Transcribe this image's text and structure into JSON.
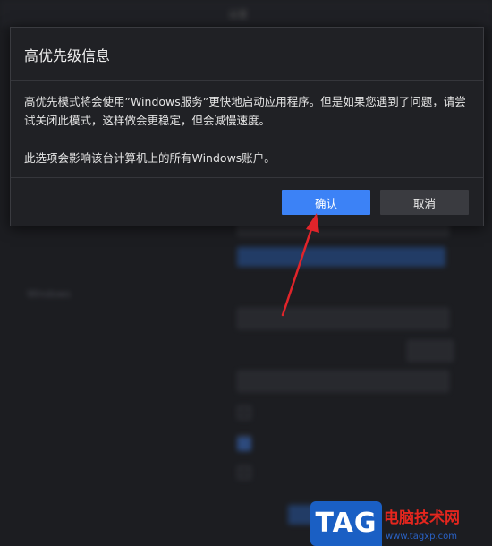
{
  "background": {
    "window_title": "设置",
    "section_heading": "Windows"
  },
  "dialog": {
    "title": "高优先级信息",
    "paragraph1": "高优先模式将会使用”Windows服务”更快地启动应用程序。但是如果您遇到了问题，请尝试关闭此模式，这样做会更稳定，但会减慢速度。",
    "paragraph2": "此选项会影响该台计算机上的所有Windows账户。",
    "confirm_label": "确认",
    "cancel_label": "取消"
  },
  "watermark": {
    "tag": "TAG",
    "site_name": "电脑技术网",
    "url": "www.tagxp.com"
  },
  "colors": {
    "accent": "#3c82f6",
    "annotation_arrow": "#e0242a",
    "dialog_bg": "#202125"
  }
}
